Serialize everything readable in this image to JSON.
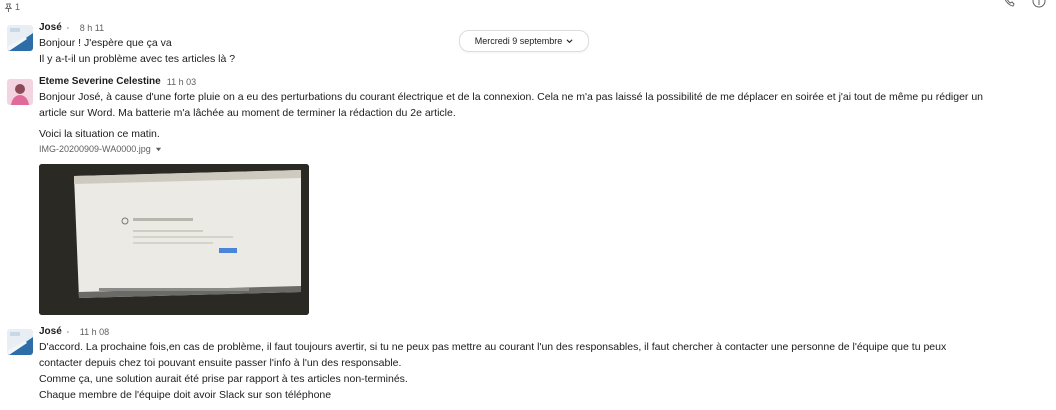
{
  "pinned": {
    "count": "1"
  },
  "date_divider": {
    "label": "Mercredi 9 septembre"
  },
  "messages": [
    {
      "author": "José",
      "time": "8 h 11",
      "lines": [
        "Bonjour ! J'espère que ça va",
        "Il y a-t-il un problème avec tes articles là ?"
      ]
    },
    {
      "author": "Eteme Severine Celestine",
      "time": "11 h 03",
      "lines": [
        "Bonjour José, à cause d'une forte pluie on a eu des perturbations du courant électrique et de la connexion. Cela ne m'a pas laissé la possibilité de me déplacer en soirée et j'ai tout de même pu rédiger un",
        "article sur Word. Ma batterie m'a lâchée au moment de terminer la rédaction du 2e article.",
        "Voici la situation ce matin."
      ],
      "file": {
        "name": "IMG-20200909-WA0000.jpg"
      }
    },
    {
      "author": "José",
      "time": "11 h 08",
      "lines": [
        "D'accord. La prochaine fois,en cas de problème, il faut toujours avertir, si tu ne peux pas mettre au courant l'un des responsables, il faut chercher à contacter une personne de l'équipe que tu peux",
        "contacter depuis chez toi pouvant ensuite passer l'info à l'un des responsable.",
        "Comme ça, une solution aurait été prise par rapport à tes articles non-terminés.",
        "Chaque membre de l'équipe doit avoir Slack sur son téléphone"
      ]
    }
  ]
}
